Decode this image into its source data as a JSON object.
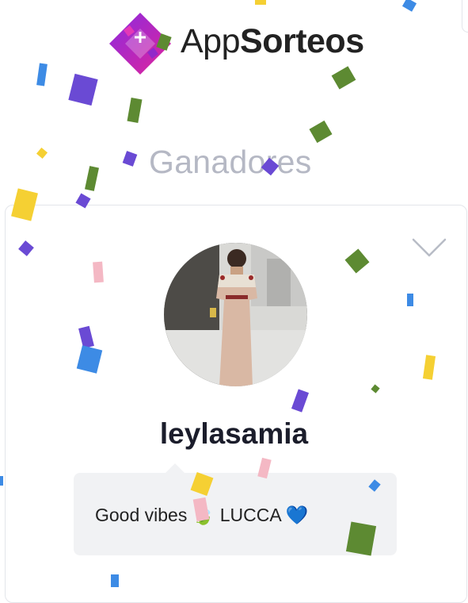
{
  "app": {
    "brand_prefix": "App",
    "brand_suffix": "Sorteos",
    "colors": {
      "logo_primary": "#c2207e",
      "logo_secondary": "#7b2ad1",
      "title_gray": "#b5b8c4"
    }
  },
  "section": {
    "title": "Ganadores"
  },
  "winner": {
    "username": "leylasamia",
    "comment": "Good vibes 🍃 LUCCA 💙",
    "avatar_description": "profile-photo"
  },
  "icons": {
    "expand": "chevron-down-icon"
  }
}
